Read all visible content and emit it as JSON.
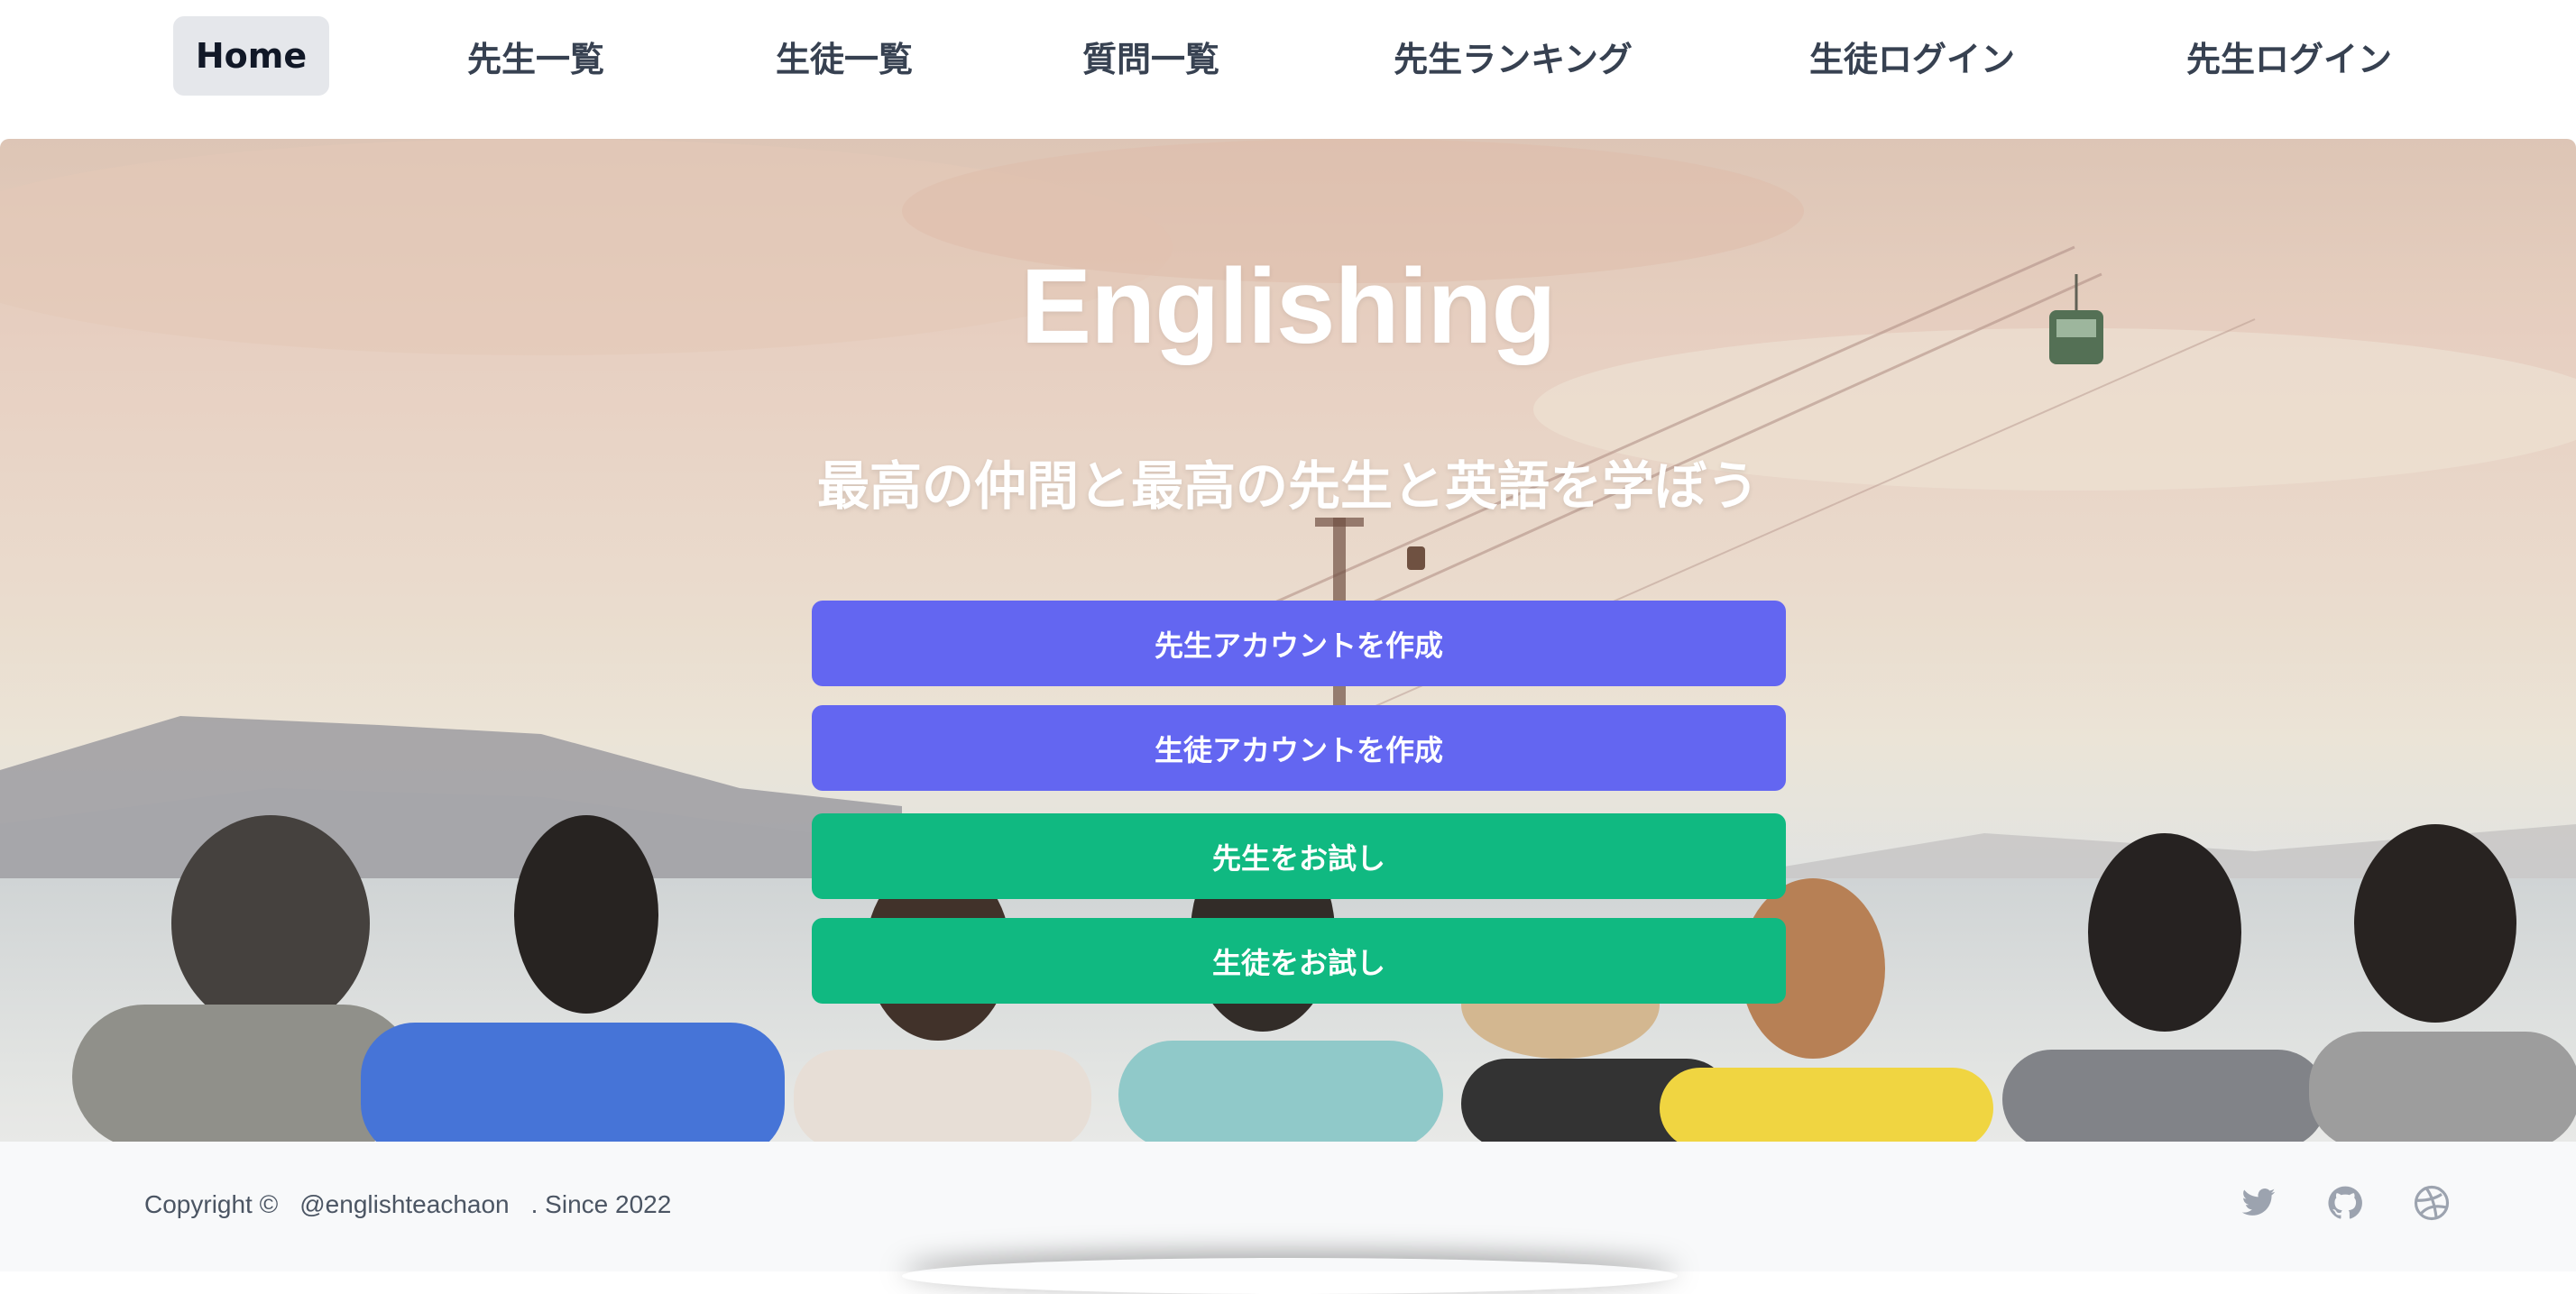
{
  "nav": {
    "items": [
      {
        "label": "Home",
        "active": true
      },
      {
        "label": "先生一覧"
      },
      {
        "label": "生徒一覧"
      },
      {
        "label": "質問一覧"
      },
      {
        "label": "先生ランキング"
      },
      {
        "label": "生徒ログイン"
      },
      {
        "label": "先生ログイン"
      }
    ]
  },
  "hero": {
    "title": "Englishing",
    "subtitle": "最高の仲間と最高の先生と英語を学ぼう",
    "buttons": [
      {
        "label": "先生アカウントを作成",
        "color": "#6366f1"
      },
      {
        "label": "生徒アカウントを作成",
        "color": "#6366f1"
      },
      {
        "label": "先生をお試し",
        "color": "#10b981"
      },
      {
        "label": "生徒をお試し",
        "color": "#10b981"
      }
    ]
  },
  "footer": {
    "copyright_prefix": "Copyright ©",
    "handle": "@englishteachaon",
    "since": ". Since 2022",
    "social": [
      "twitter-icon",
      "github-icon",
      "dribbble-icon"
    ]
  }
}
